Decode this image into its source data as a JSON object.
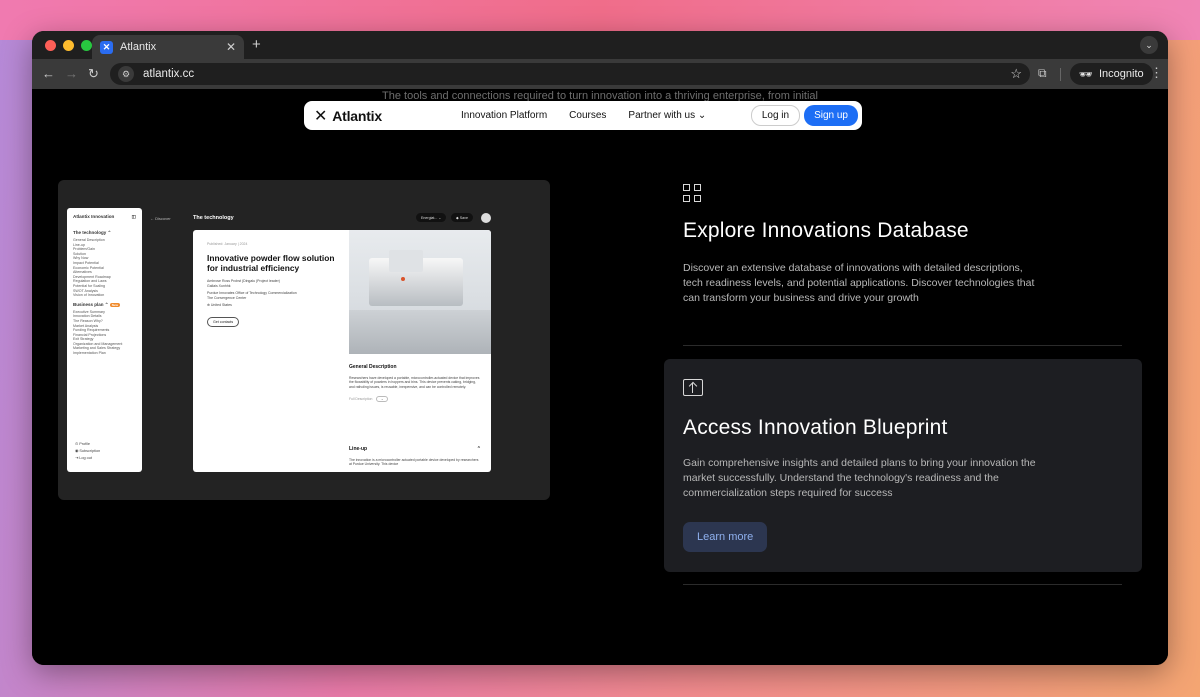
{
  "browser": {
    "tab_title": "Atlantix",
    "url": "atlantix.cc",
    "incognito_label": "Incognito"
  },
  "page": {
    "hero_text": "The tools and connections required to turn innovation into a thriving enterprise, from initial",
    "nav": {
      "brand": "Atlantix",
      "links": [
        "Innovation Platform",
        "Courses",
        "Partner with us"
      ],
      "login": "Log in",
      "signup": "Sign up"
    },
    "preview": {
      "sidebar_title": "Atlantix Innovation",
      "section1_title": "The technology",
      "section1_items": [
        "General Description",
        "Line-up",
        "Problem/Gain",
        "Solution",
        "Why Now",
        "Impact Potential",
        "Economic Potential",
        "Alternatives",
        "Development Roadmap",
        "Regulation and Laws",
        "Potential for Scaling",
        "SWOT Analysis",
        "Vision of Innovation"
      ],
      "section2_title": "Business plan",
      "section2_badge": "New",
      "section2_items": [
        "Executive Summary",
        "Innovation Details",
        "The Reason Why?",
        "Market Analysis",
        "Funding Requirements",
        "Financial Projections",
        "Exit Strategy",
        "Organization and Management",
        "Marketing and Sales Strategy",
        "Implementation Plan"
      ],
      "bottom_items": [
        "Profile",
        "Subscription",
        "Log out"
      ],
      "back_label": "Discover",
      "header_title": "The technology",
      "pill1": "Energiat...",
      "pill2": "Save",
      "date": "Published: January | 2024",
      "headline": "Innovative powder flow solution for industrial efficiency",
      "author": "Ambrose Ross Probst (Dingalu (Project leader)",
      "author2": "Gallais Xunhhk",
      "org": "Purdue Innovates Office of Technology Commercialization",
      "org2": "The Convergence Center",
      "country": "United States",
      "contact_btn": "Get contacts",
      "gd_title": "General Description",
      "gd_text": "Researchers have developed a portable, microcontroller-actuated device that improves the flowability of powders in hoppers and bins. This device prevents caking, bridging, and ratholing issues, is reusable, inexpensive, and can be controlled remotely.",
      "gd_more": "Full Description",
      "lineup_title": "Line-up",
      "lineup_text": "The innovation is a microcontroller actuated portable device developed by researchers at Purdue University. This device"
    },
    "features": [
      {
        "icon": "grid-icon",
        "title": "Explore Innovations Database",
        "text": "Discover an extensive database of innovations with detailed descriptions, tech readiness levels, and potential applications. Discover technologies that can transform your business and drive your growth"
      },
      {
        "icon": "upload-icon",
        "title": "Access Innovation Blueprint",
        "text": "Gain comprehensive insights and detailed plans to bring your innovation the market successfully. Understand the technology's readiness and the commercialization steps required for success",
        "button": "Learn more"
      }
    ]
  }
}
